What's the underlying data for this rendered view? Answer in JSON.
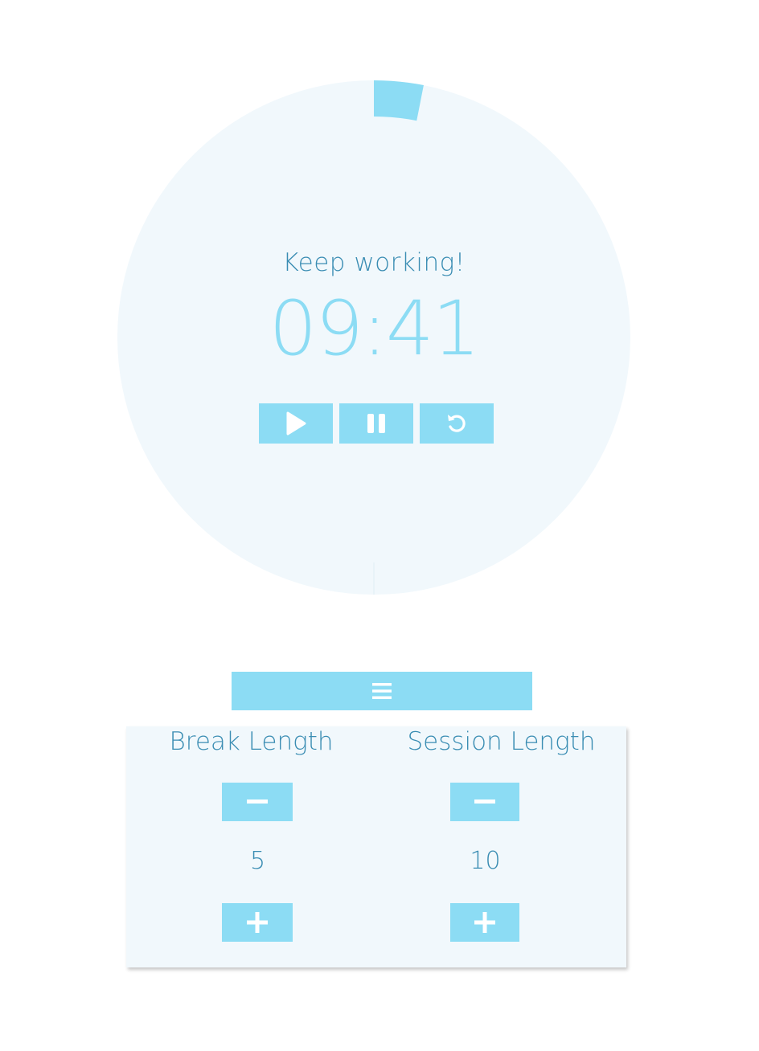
{
  "timer": {
    "status": "Keep working!",
    "time": "09:41",
    "elapsed_fraction": 0.031
  },
  "controls": {
    "play_icon": "play-icon",
    "pause_icon": "pause-icon",
    "reset_icon": "reset-icon"
  },
  "menu": {
    "icon": "hamburger-menu-icon"
  },
  "settings": {
    "break": {
      "title": "Break Length",
      "value": "5",
      "decrement_icon": "minus-icon",
      "increment_icon": "plus-icon"
    },
    "session": {
      "title": "Session Length",
      "value": "10",
      "decrement_icon": "minus-icon",
      "increment_icon": "plus-icon"
    }
  },
  "colors": {
    "accent": "#8cdcf4",
    "text": "#3a8db3",
    "panel_bg": "#f1f8fc",
    "page_bg": "#ffffff"
  }
}
